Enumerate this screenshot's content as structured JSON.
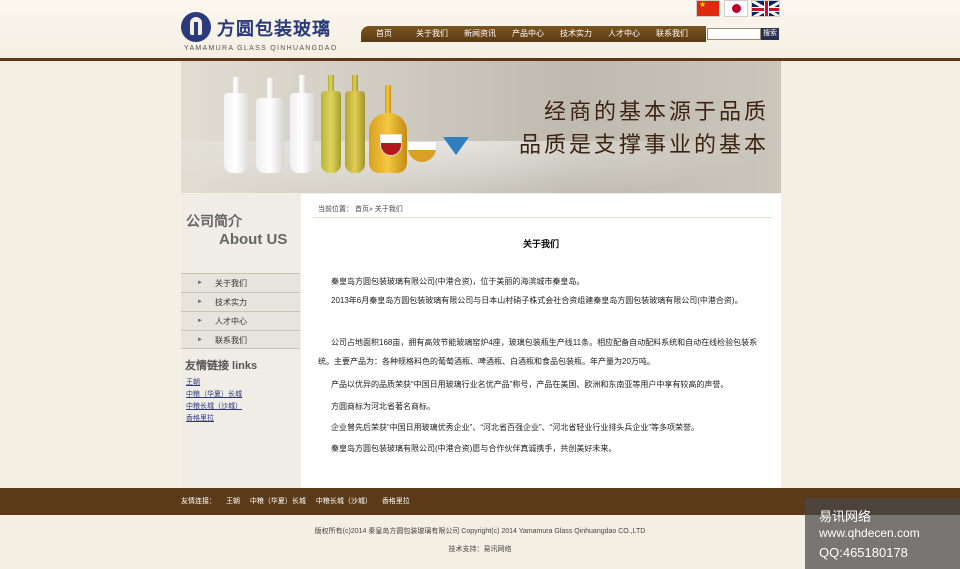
{
  "header": {
    "logo_cn": "方圆包装玻璃",
    "logo_en": "YAMAMURA GLASS QINHUANGDAO",
    "flags": [
      "china-flag-icon",
      "japan-flag-icon",
      "uk-flag-icon"
    ]
  },
  "nav": {
    "items": [
      "首页",
      "关于我们",
      "新闻资讯",
      "产品中心",
      "技术实力",
      "人才中心",
      "联系我们"
    ]
  },
  "search": {
    "placeholder": "",
    "button_label": "搜索"
  },
  "banner": {
    "slogan_line1": "经商的基本源于品质",
    "slogan_line2": "品质是支撑事业的基本"
  },
  "sidebar": {
    "title_cn": "公司简介",
    "title_en": "About US",
    "menu": [
      "关于我们",
      "技术实力",
      "人才中心",
      "联系我们"
    ],
    "friends_title": "友情链接 links",
    "friend_links": [
      "王朝",
      "中粮（华夏）长城",
      "中粮长城（沙城）",
      "香格里拉"
    ]
  },
  "content": {
    "breadcrumb": "当前位置： 首页» 关于我们",
    "title": "关于我们",
    "paragraphs": [
      "秦皇岛方圆包装玻璃有限公司(中港合资)，位于美丽的海滨城市秦皇岛。",
      "2013年6月秦皇岛方圆包装玻璃有限公司与日本山村硝子株式会社合资组建秦皇岛方圆包装玻璃有限公司(中港合资)。",
      "公司占地面积168亩，拥有高效节能玻璃窑炉4座，玻璃包装瓶生产线11条。相应配备自动配料系统和自动在线检验包装系统。主要产品为：各种规格料色的葡萄酒瓶、啤酒瓶、白酒瓶和食品包装瓶。年产量为20万吨。",
      "产品以优异的品质荣获“中国日用玻璃行业名优产品”称号，产品在美国、欧洲和东南亚等用户中享有较高的声誉。",
      "方圆商标为河北省著名商标。",
      "企业曾先后荣获“中国日用玻璃优秀企业”、“河北省百强企业”、“河北省轻业行业排头兵企业”等多项荣誉。",
      "秦皇岛方圆包装玻璃有限公司(中港合资)愿与合作伙伴真诚携手，共创美好未来。"
    ]
  },
  "footer": {
    "links_label": "友情连接：",
    "links": [
      "王朝",
      "中粮（华夏）长城",
      "中粮长城（沙城）",
      "香格里拉"
    ],
    "copyright": "版权所有(c)2014 秦皇岛方圆包装玻璃有限公司 Copyright(c) 2014 Yamamura Glass Qinhuangdao CO.,LTD",
    "tech_support": "技术支持：易讯网络"
  },
  "watermark": {
    "name": "易讯网络",
    "url": "www.qhdecen.com",
    "qq": "QQ:465180178"
  },
  "colors": {
    "brand_brown": "#5c3a19",
    "brand_navy": "#2b3a7b",
    "page_bg": "#f4efe2"
  }
}
